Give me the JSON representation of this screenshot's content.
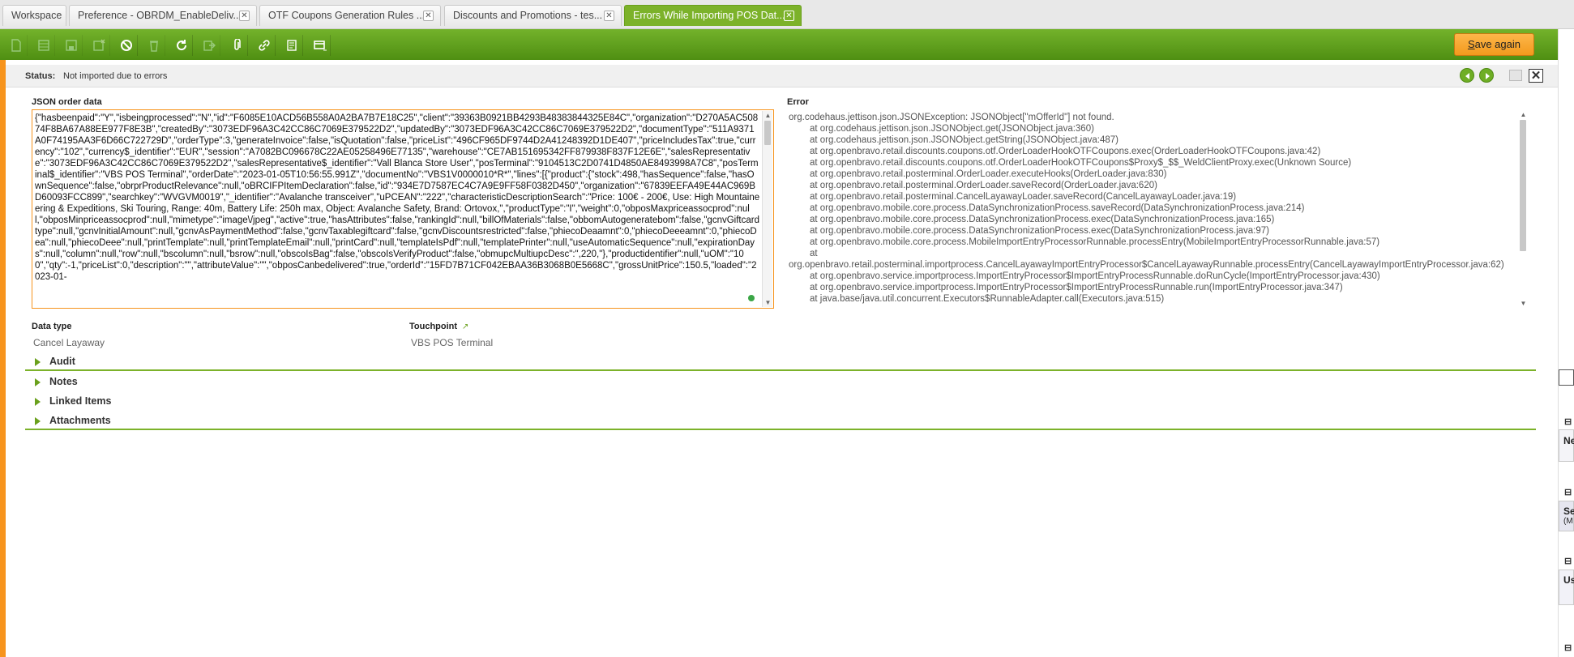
{
  "tabs": [
    {
      "label": "Workspace",
      "closable": false
    },
    {
      "label": "Preference - OBRDM_EnableDeliv...",
      "closable": true
    },
    {
      "label": "OTF Coupons Generation Rules ...",
      "closable": true
    },
    {
      "label": "Discounts and Promotions - tes...",
      "closable": true
    },
    {
      "label": "Errors While Importing POS Dat...",
      "closable": true,
      "active": true
    }
  ],
  "toolbar": {
    "icons": [
      "new-document-icon",
      "new-row-icon",
      "save-icon",
      "save-close-icon",
      "undo-icon",
      "delete-icon",
      "refresh-icon",
      "export-icon",
      "attachment-icon",
      "link-icon",
      "print-icon",
      "grid-view-icon"
    ],
    "save_again_label": "Save again",
    "save_again_prefix": "S",
    "save_again_rest": "ave again"
  },
  "status": {
    "label": "Status:",
    "value": "Not imported due to errors"
  },
  "json_field": {
    "label": "JSON order data",
    "value": "{\"hasbeenpaid\":\"Y\",\"isbeingprocessed\":\"N\",\"id\":\"F6085E10ACD56B558A0A2BA7B7E18C25\",\"client\":\"39363B0921BB4293B48383844325E84C\",\"organization\":\"D270A5AC50874F8BA67A88EE977F8E3B\",\"createdBy\":\"3073EDF96A3C42CC86C7069E379522D2\",\"updatedBy\":\"3073EDF96A3C42CC86C7069E379522D2\",\"documentType\":\"511A9371A0F74195AA3F6D66C722729D\",\"orderType\":3,\"generateInvoice\":false,\"isQuotation\":false,\"priceList\":\"496CF965DF9744D2A41248392D1DE407\",\"priceIncludesTax\":true,\"currency\":\"102\",\"currency$_identifier\":\"EUR\",\"session\":\"A7082BC096678C22AE05258496E77135\",\"warehouse\":\"CE7AB151695342FF879938F837F12E6E\",\"salesRepresentative\":\"3073EDF96A3C42CC86C7069E379522D2\",\"salesRepresentative$_identifier\":\"Vall Blanca Store User\",\"posTerminal\":\"9104513C2D0741D4850AE8493998A7C8\",\"posTerminal$_identifier\":\"VBS POS Terminal\",\"orderDate\":\"2023-01-05T10:56:55.991Z\",\"documentNo\":\"VBS1V0000010*R*\",\"lines\":[{\"product\":{\"stock\":498,\"hasSequence\":false,\"hasOwnSequence\":false,\"obrprProductRelevance\":null,\"oBRCIFPItemDeclaration\":false,\"id\":\"934E7D7587EC4C7A9E9FF58F0382D450\",\"organization\":\"67839EEFA49E44AC969BD60093FCC899\",\"searchkey\":\"WVGVM0019\",\"_identifier\":\"Avalanche transceiver\",\"uPCEAN\":\"222\",\"characteristicDescriptionSearch\":\"Price: 100€ - 200€, Use: High Mountaineering & Expeditions, Ski Touring, Range: 40m, Battery Life: 250h max, Object: Avalanche Safety, Brand: Ortovox,\",\"productType\":\"I\",\"weight\":0,\"obposMaxpriceassocprod\":null,\"obposMinpriceassocprod\":null,\"mimetype\":\"image\\/jpeg\",\"active\":true,\"hasAttributes\":false,\"rankingId\":null,\"billOfMaterials\":false,\"obbomAutogeneratebom\":false,\"gcnvGiftcardtype\":null,\"gcnvInitialAmount\":null,\"gcnvAsPaymentMethod\":false,\"gcnvTaxablegiftcard\":false,\"gcnvDiscountsrestricted\":false,\"phiecoDeaamnt\":0,\"phiecoDeeeamnt\":0,\"phiecoDea\":null,\"phiecoDeee\":null,\"printTemplate\":null,\"printTemplateEmail\":null,\"printCard\":null,\"templateIsPdf\":null,\"templatePrinter\":null,\"useAutomaticSequence\":null,\"expirationDays\":null,\"column\":null,\"row\":null,\"bscolumn\":null,\"bsrow\":null,\"obscoIsBag\":false,\"obscoIsVerifyProduct\":false,\"obmupcMultiupcDesc\":\",220,\"},\"productidentifier\":null,\"uOM\":\"100\",\"qty\":-1,\"priceList\":0,\"description\":\"\",\"attributeValue\":\"\",\"obposCanbedelivered\":true,\"orderId\":\"15FD7B71CF042EBAA36B3068B0E5668C\",\"grossUnitPrice\":150.5,\"loaded\":\"2023-01-"
  },
  "error_field": {
    "label": "Error",
    "lines": [
      {
        "text": "org.codehaus.jettison.json.JSONException: JSONObject[\"mOfferId\"] not found.",
        "indent": false
      },
      {
        "text": "at org.codehaus.jettison.json.JSONObject.get(JSONObject.java:360)",
        "indent": true
      },
      {
        "text": "at org.codehaus.jettison.json.JSONObject.getString(JSONObject.java:487)",
        "indent": true
      },
      {
        "text": "at org.openbravo.retail.discounts.coupons.otf.OrderLoaderHookOTFCoupons.exec(OrderLoaderHookOTFCoupons.java:42)",
        "indent": true
      },
      {
        "text": "at org.openbravo.retail.discounts.coupons.otf.OrderLoaderHookOTFCoupons$Proxy$_$$_WeldClientProxy.exec(Unknown Source)",
        "indent": true
      },
      {
        "text": "at org.openbravo.retail.posterminal.OrderLoader.executeHooks(OrderLoader.java:830)",
        "indent": true
      },
      {
        "text": "at org.openbravo.retail.posterminal.OrderLoader.saveRecord(OrderLoader.java:620)",
        "indent": true
      },
      {
        "text": "at org.openbravo.retail.posterminal.CancelLayawayLoader.saveRecord(CancelLayawayLoader.java:19)",
        "indent": true
      },
      {
        "text": "at org.openbravo.mobile.core.process.DataSynchronizationProcess.saveRecord(DataSynchronizationProcess.java:214)",
        "indent": true
      },
      {
        "text": "at org.openbravo.mobile.core.process.DataSynchronizationProcess.exec(DataSynchronizationProcess.java:165)",
        "indent": true
      },
      {
        "text": "at org.openbravo.mobile.core.process.DataSynchronizationProcess.exec(DataSynchronizationProcess.java:97)",
        "indent": true
      },
      {
        "text": "at org.openbravo.mobile.core.process.MobileImportEntryProcessorRunnable.processEntry(MobileImportEntryProcessorRunnable.java:57)",
        "indent": true
      },
      {
        "text": "at",
        "indent": true
      },
      {
        "text": "org.openbravo.retail.posterminal.importprocess.CancelLayawayImportEntryProcessor$CancelLayawayRunnable.processEntry(CancelLayawayImportEntryProcessor.java:62)",
        "indent": false,
        "wrap": true
      },
      {
        "text": "at org.openbravo.service.importprocess.ImportEntryProcessor$ImportEntryProcessRunnable.doRunCycle(ImportEntryProcessor.java:430)",
        "indent": true
      },
      {
        "text": "at org.openbravo.service.importprocess.ImportEntryProcessor$ImportEntryProcessRunnable.run(ImportEntryProcessor.java:347)",
        "indent": true
      },
      {
        "text": "at java.base/java.util.concurrent.Executors$RunnableAdapter.call(Executors.java:515)",
        "indent": true
      }
    ]
  },
  "data_type": {
    "label": "Data type",
    "value": "Cancel Layaway"
  },
  "touchpoint": {
    "label": "Touchpoint",
    "value": "VBS POS Terminal",
    "link_icon": "external-link-icon"
  },
  "sections": [
    {
      "label": "Audit"
    },
    {
      "label": "Notes"
    },
    {
      "label": "Linked Items"
    },
    {
      "label": "Attachments"
    }
  ],
  "right_panel": {
    "items": [
      {
        "label": "Ne"
      },
      {
        "label": "Se",
        "sub": "(M"
      },
      {
        "label": "Us"
      }
    ]
  },
  "colors": {
    "toolbar_green": "#5d9e1d",
    "accent_orange": "#f7941d",
    "section_line": "#7cb22a",
    "save_button": "#f6a52c"
  }
}
